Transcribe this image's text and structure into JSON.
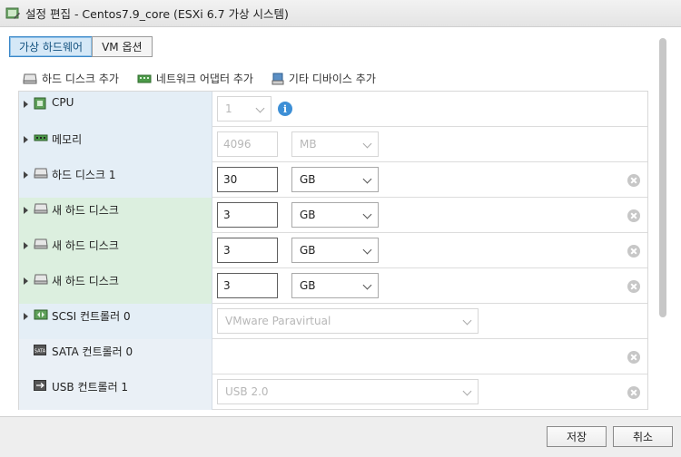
{
  "window": {
    "title": "설정 편집 - Centos7.9_core (ESXi 6.7 가상 시스템)"
  },
  "tabs": [
    {
      "label": "가상 하드웨어",
      "active": true
    },
    {
      "label": "VM 옵션",
      "active": false
    }
  ],
  "toolbar": {
    "add_disk": "하드 디스크 추가",
    "add_network": "네트워크 어댑터 추가",
    "add_other": "기타 디바이스 추가"
  },
  "devices": [
    {
      "label": "CPU",
      "icon": "cpu-icon",
      "value": "1"
    },
    {
      "label": "메모리",
      "icon": "memory-icon",
      "value": "4096",
      "unit": "MB"
    },
    {
      "label": "하드 디스크 1",
      "icon": "hard-disk-icon",
      "value": "30",
      "unit": "GB"
    },
    {
      "label": "새 하드 디스크",
      "icon": "hard-disk-icon",
      "value": "3",
      "unit": "GB"
    },
    {
      "label": "새 하드 디스크",
      "icon": "hard-disk-icon",
      "value": "3",
      "unit": "GB"
    },
    {
      "label": "새 하드 디스크",
      "icon": "hard-disk-icon",
      "value": "3",
      "unit": "GB"
    },
    {
      "label": "SCSI 컨트롤러 0",
      "icon": "scsi-controller-icon",
      "value": "VMware Paravirtual"
    },
    {
      "label": "SATA 컨트롤러 0",
      "icon": "sata-controller-icon"
    },
    {
      "label": "USB 컨트롤러 1",
      "icon": "usb-controller-icon",
      "value": "USB 2.0"
    }
  ],
  "footer": {
    "save": "저장",
    "cancel": "취소"
  },
  "colors": {
    "accent": "#3a87c8",
    "device_label_bg": "#e4eef6",
    "new_device_bg": "#dcefdf"
  }
}
